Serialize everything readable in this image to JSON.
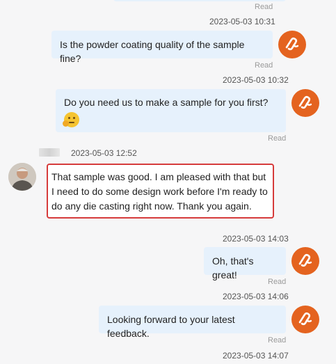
{
  "messages": [
    {
      "side": "right",
      "read": "Read"
    },
    {
      "side": "right",
      "timestamp": "2023-05-03 10:31",
      "text": "Is the powder coating quality of the sample fine?",
      "read": "Read"
    },
    {
      "side": "right",
      "timestamp": "2023-05-03 10:32",
      "text": "Do you need us to make a sample for you first?",
      "emoji": "thinking-face-icon",
      "read": "Read"
    },
    {
      "side": "left",
      "timestamp": "2023-05-03 12:52",
      "text_lines": [
        "That sample was good. I am pleased with that but",
        "I need to do some design work before I'm ready to",
        "do any die casting right now. Thank you again."
      ],
      "highlighted": true
    },
    {
      "side": "right",
      "timestamp": "2023-05-03 14:03",
      "text": "Oh, that's great!",
      "read": "Read"
    },
    {
      "side": "right",
      "timestamp": "2023-05-03 14:06",
      "text": "Looking forward to your latest feedback.",
      "read": "Read"
    },
    {
      "side": "right",
      "timestamp": "2023-05-03 14:07"
    }
  ],
  "colors": {
    "brand_avatar": "#e4631f",
    "right_bubble": "#e6f1fc",
    "highlight_border": "#d63b3b"
  }
}
